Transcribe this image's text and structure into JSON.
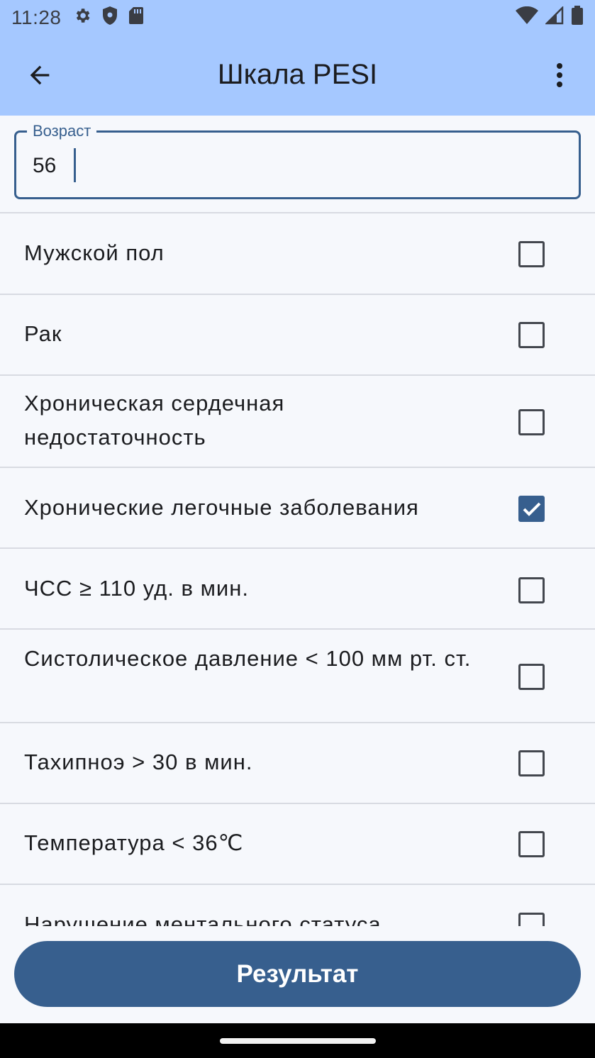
{
  "status_bar": {
    "time": "11:28",
    "left_icons": [
      "gear-icon",
      "shield-icon",
      "sd-card-icon"
    ],
    "right_icons": [
      "wifi-icon",
      "cell-signal-icon",
      "battery-icon"
    ]
  },
  "app_bar": {
    "title": "Шкала PESI",
    "back_icon": "arrow-left-icon",
    "menu_icon": "more-vert-icon"
  },
  "age_field": {
    "label": "Возраст",
    "value": "56"
  },
  "criteria": [
    {
      "label": "Мужской пол",
      "checked": false
    },
    {
      "label": "Рак",
      "checked": false
    },
    {
      "label": "Хроническая сердечная недостаточность",
      "checked": false
    },
    {
      "label": "Хронические легочные заболевания",
      "checked": true
    },
    {
      "label": "ЧСС ≥ 110 уд. в мин.",
      "checked": false
    },
    {
      "label": "Систолическое давление < 100 мм рт. ст.",
      "checked": false
    },
    {
      "label": "Тахипноэ > 30 в мин.",
      "checked": false
    },
    {
      "label": "Температура < 36℃",
      "checked": false
    },
    {
      "label": "Нарушение ментального статуса",
      "checked": false
    }
  ],
  "result_button": {
    "label": "Результат"
  },
  "colors": {
    "app_bar": "#a5c8ff",
    "primary": "#375f8e",
    "background": "#f6f8fc"
  }
}
